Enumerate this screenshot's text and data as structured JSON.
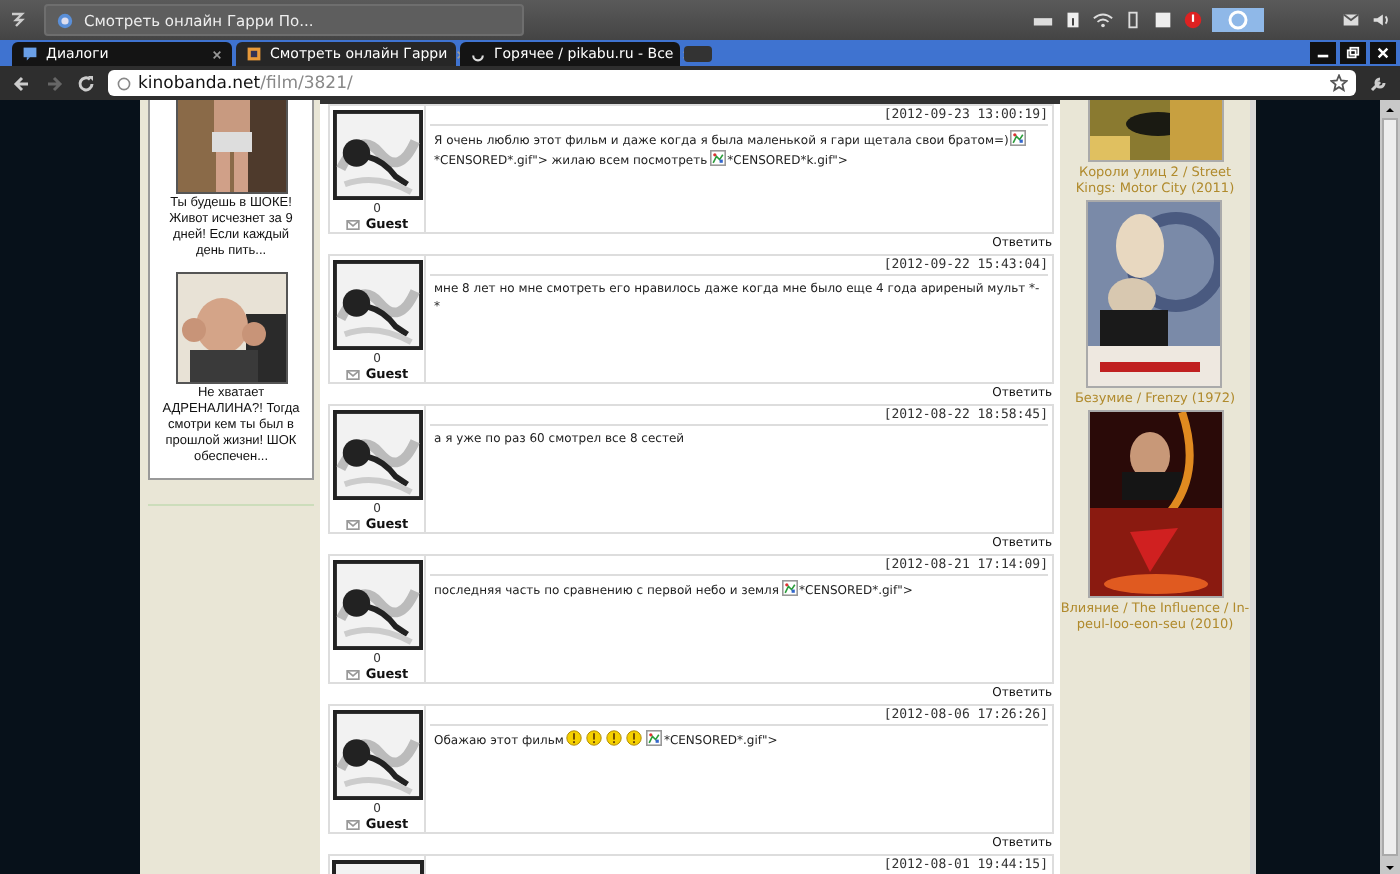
{
  "taskbar": {
    "window_title": "Смотреть онлайн Гарри По..."
  },
  "tabs": [
    {
      "label": "Диалоги",
      "kind": "chat",
      "selected": false
    },
    {
      "label": "Смотреть онлайн Гарри",
      "kind": "film",
      "selected": true
    },
    {
      "label": "Горячее / pikabu.ru - Все",
      "kind": "loading",
      "selected": false
    }
  ],
  "address_bar": {
    "domain": "kinobanda.net",
    "path": "/film/3821/"
  },
  "left_ads": [
    {
      "caption": "Ты будешь в ШОКЕ! Живот исчезнет за 9 дней! Если каждый день пить..."
    },
    {
      "caption": "Не хватает АДРЕНАЛИНА?! Тогда смотри кем ты был в прошлой жизни! ШОК обеспечен..."
    }
  ],
  "comments": [
    {
      "date": "[2012-09-23 13:00:19]",
      "rating": "0",
      "author": "Guest",
      "reply": "Ответить",
      "body": [
        {
          "kind": "text",
          "text": "Я очень люблю этот фильм и даже когда я была маленькой я гари щетала свои братом=)"
        },
        {
          "kind": "broken_image"
        },
        {
          "kind": "text",
          "text": "*CENSORED*.gif\"> жилаю всем посмотреть"
        },
        {
          "kind": "broken_image"
        },
        {
          "kind": "text",
          "text": "*CENSORED*k.gif\">"
        }
      ]
    },
    {
      "date": "[2012-09-22 15:43:04]",
      "rating": "0",
      "author": "Guest",
      "reply": "Ответить",
      "body": [
        {
          "kind": "text",
          "text": "мне 8 лет но мне смотреть его нравилось даже когда мне было еще 4 года ариреный мульт *-*"
        }
      ]
    },
    {
      "date": "[2012-08-22 18:58:45]",
      "rating": "0",
      "author": "Guest",
      "reply": "Ответить",
      "body": [
        {
          "kind": "text",
          "text": "а я уже по раз 60 смотрел все 8 сестей"
        }
      ]
    },
    {
      "date": "[2012-08-21 17:14:09]",
      "rating": "0",
      "author": "Guest",
      "reply": "Ответить",
      "body": [
        {
          "kind": "text",
          "text": "последняя часть по сравнению с первой небо и земля"
        },
        {
          "kind": "broken_image"
        },
        {
          "kind": "text",
          "text": "*CENSORED*.gif\">"
        }
      ]
    },
    {
      "date": "[2012-08-06 17:26:26]",
      "rating": "0",
      "author": "Guest",
      "reply": "Ответить",
      "body": [
        {
          "kind": "text",
          "text": "Обажаю этот фильм"
        },
        {
          "kind": "smiley"
        },
        {
          "kind": "smiley"
        },
        {
          "kind": "smiley"
        },
        {
          "kind": "smiley"
        },
        {
          "kind": "broken_image"
        },
        {
          "kind": "text",
          "text": "*CENSORED*.gif\">"
        }
      ]
    },
    {
      "date": "[2012-08-01 19:44:15]"
    }
  ],
  "related_films": [
    {
      "caption": "Короли улиц 2 / Street Kings: Motor City (2011)"
    },
    {
      "caption": "Безумие / Frenzy (1972)"
    },
    {
      "caption": "Влияние / The Influence / In-peul-loo-eon-seu (2010)"
    }
  ]
}
